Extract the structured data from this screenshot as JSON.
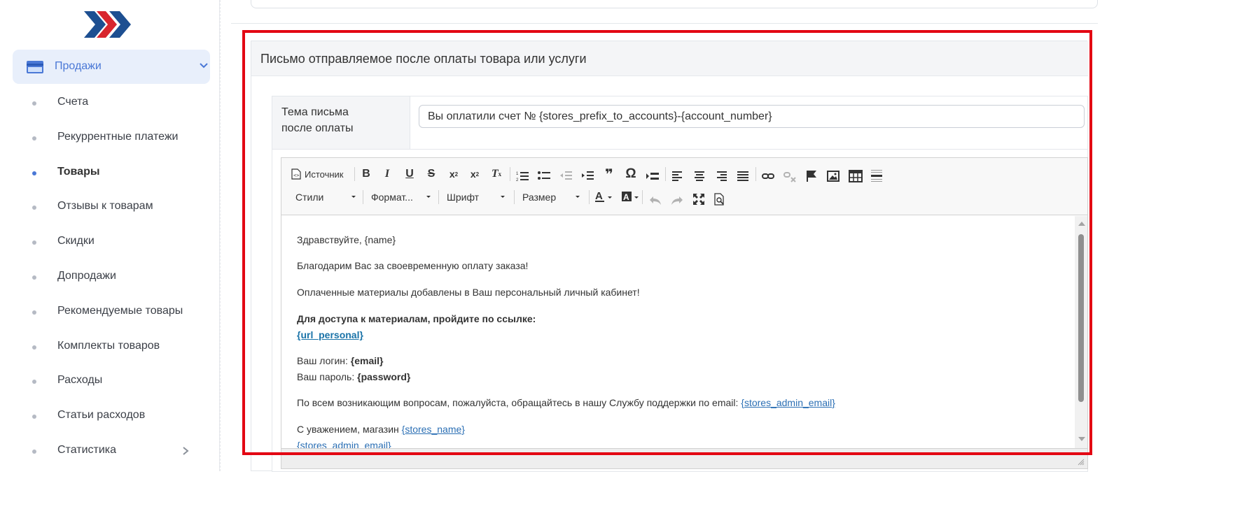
{
  "sidebar": {
    "active_section": "Продажи",
    "items": [
      {
        "label": "Счета"
      },
      {
        "label": "Рекуррентные платежи"
      },
      {
        "label": "Товары",
        "active": true
      },
      {
        "label": "Отзывы к товарам"
      },
      {
        "label": "Скидки"
      },
      {
        "label": "Допродажи"
      },
      {
        "label": "Рекомендуемые товары"
      },
      {
        "label": "Комплекты товаров"
      },
      {
        "label": "Расходы"
      },
      {
        "label": "Статьи расходов"
      },
      {
        "label": "Статистика"
      }
    ]
  },
  "panel": {
    "title": "Письмо отправляемое после оплаты товара или услуги",
    "subject_label_line1": "Тема письма",
    "subject_label_line2": "после оплаты",
    "subject_value": "Вы оплатили счет № {stores_prefix_to_accounts}-{account_number}"
  },
  "toolbar": {
    "source_label": "Источник",
    "styles": "Стили",
    "format": "Формат...",
    "font": "Шрифт",
    "size": "Размер",
    "omega": "Ω",
    "quote": "❞"
  },
  "content": {
    "greeting": "Здравствуйте, {name}",
    "thanks": "Благодарим Вас за своевременную оплату заказа!",
    "materials": "Оплаченные материалы добавлены в Ваш персональный личный кабинет!",
    "access": "Для доступа к материалам, пройдите по ссылке:",
    "url_personal": "{url_personal}",
    "login_label": "Ваш логин: ",
    "login_value": "{email}",
    "password_label": "Ваш пароль: ",
    "password_value": "{password}",
    "support_text": "По всем возникающим вопросам, пожалуйста, обращайтесь в нашу Службу поддержки по email: ",
    "support_email": "{stores_admin_email}",
    "regards_text": "С уважением, магазин ",
    "store_name": "{stores_name}",
    "footer_email": "{stores_admin_email}"
  },
  "colors": {
    "accent": "#4a78d6",
    "highlight": "#e30613",
    "logo_blue": "#1d4f91",
    "logo_red": "#d8262e"
  }
}
